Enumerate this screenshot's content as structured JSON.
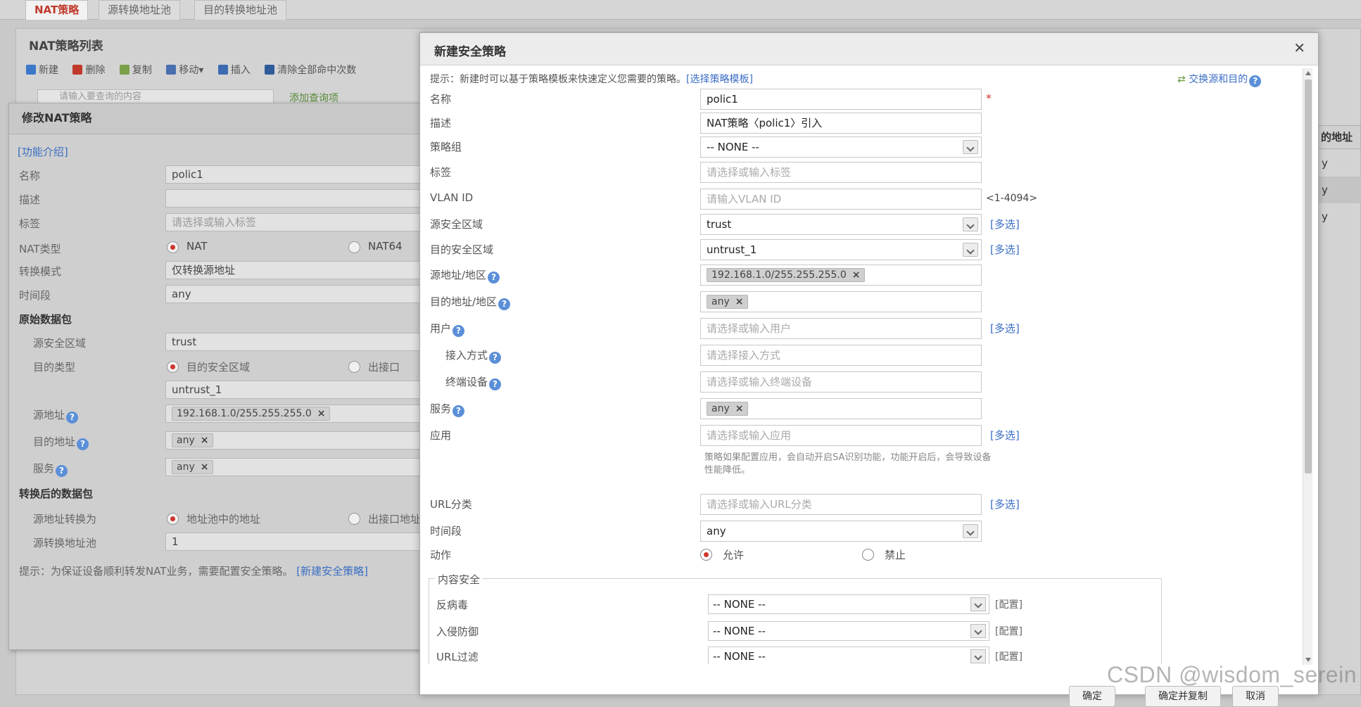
{
  "bg": {
    "tabs": [
      "NAT策略",
      "源转换地址池",
      "目的转换地址池"
    ],
    "panel_title": "NAT策略列表",
    "toolbar": [
      "新建",
      "删除",
      "复制",
      "移动▾",
      "插入",
      "清除全部命中次数"
    ],
    "search_placeholder": "请输入要查询的内容",
    "add_query": "添加查询项",
    "column_header": "的地址",
    "column_cells": [
      "y",
      "y",
      "y"
    ]
  },
  "nat": {
    "title": "修改NAT策略",
    "intro": "[功能介绍]",
    "labels": {
      "name": "名称",
      "desc": "描述",
      "tag": "标签",
      "nat_type": "NAT类型",
      "mode": "转换模式",
      "time": "时间段",
      "orig": "原始数据包",
      "src_zone": "源安全区域",
      "dst_type": "目的类型",
      "src_addr": "源地址",
      "dst_addr": "目的地址",
      "service": "服务",
      "translated": "转换后的数据包",
      "src_trans": "源地址转换为",
      "pool": "源转换地址池"
    },
    "values": {
      "name": "polic1",
      "desc": "",
      "tag_placeholder": "请选择或输入标签",
      "nat_type_opt1": "NAT",
      "nat_type_opt2": "NAT64",
      "mode": "仅转换源地址",
      "time": "any",
      "src_zone": "trust",
      "dst_type_opt1": "目的安全区域",
      "dst_type_opt2": "出接口",
      "dst_zone": "untrust_1",
      "src_addr": "192.168.1.0/255.255.255.0",
      "dst_addr": "any",
      "service": "any",
      "src_trans_opt1": "地址池中的地址",
      "src_trans_opt2": "出接口地址",
      "pool": "1"
    },
    "hint": "提示：为保证设备顺利转发NAT业务，需要配置安全策略。",
    "hint_link": "[新建安全策略]"
  },
  "sec": {
    "title": "新建安全策略",
    "tip": "提示：新建时可以基于策略模板来快速定义您需要的策略。",
    "tip_link": "[选择策略模板]",
    "swap": "交换源和目的",
    "labels": {
      "name": "名称",
      "desc": "描述",
      "group": "策略组",
      "tag": "标签",
      "vlan": "VLAN ID",
      "src_zone": "源安全区域",
      "dst_zone": "目的安全区域",
      "src_addr": "源地址/地区",
      "dst_addr": "目的地址/地区",
      "user": "用户",
      "access": "接入方式",
      "device": "终端设备",
      "service": "服务",
      "app": "应用",
      "url": "URL分类",
      "time": "时间段",
      "action": "动作"
    },
    "values": {
      "name": "polic1",
      "desc": "NAT策略〈polic1〉引入",
      "group": "-- NONE --",
      "tag_placeholder": "请选择或输入标签",
      "vlan_placeholder": "请输入VLAN ID",
      "vlan_range": "<1-4094>",
      "src_zone": "trust",
      "dst_zone": "untrust_1",
      "src_addr": "192.168.1.0/255.255.255.0",
      "dst_addr": "any",
      "user_placeholder": "请选择或输入用户",
      "access_placeholder": "请选择接入方式",
      "device_placeholder": "请选择或输入终端设备",
      "service": "any",
      "app_placeholder": "请选择或输入应用",
      "app_note": "策略如果配置应用，会自动开启SA识别功能，功能开启后，会导致设备性能降低。",
      "url_placeholder": "请选择或输入URL分类",
      "time": "any",
      "allow": "允许",
      "deny": "禁止"
    },
    "multi": "[多选]",
    "content_security": {
      "legend": "内容安全",
      "rows": [
        {
          "label": "反病毒",
          "value": "-- NONE --"
        },
        {
          "label": "入侵防御",
          "value": "-- NONE --"
        },
        {
          "label": "URL过滤",
          "value": "-- NONE --"
        }
      ],
      "config": "[配置]"
    },
    "buttons": [
      "确定",
      "确定并复制",
      "取消"
    ]
  },
  "watermark": "CSDN @wisdom_serein"
}
